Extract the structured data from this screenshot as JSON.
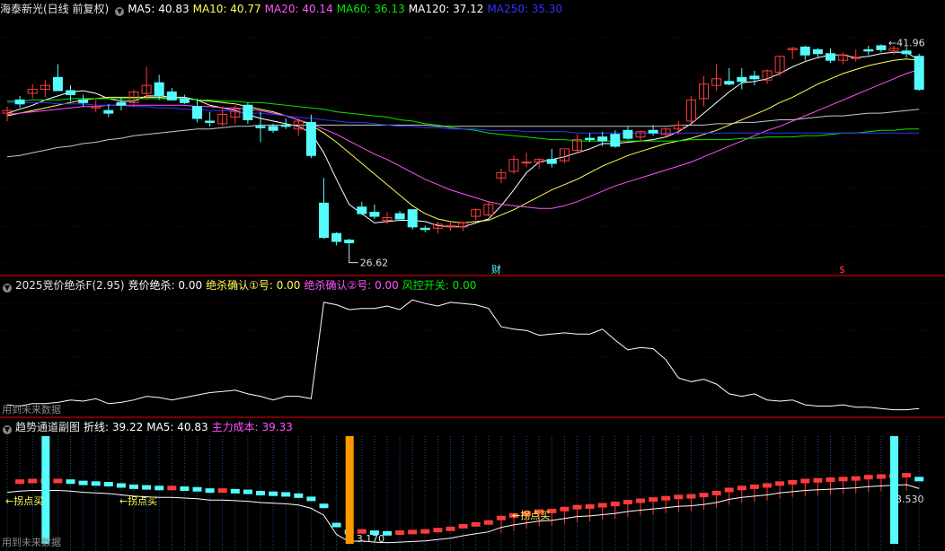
{
  "colors": {
    "up": "#ff3b3b",
    "down": "#54fcfc",
    "ma5": "#ffffff",
    "ma10": "#ffff54",
    "ma20": "#ff54ff",
    "ma60": "#00e800",
    "ma120": "#c8c8c8",
    "ma250": "#3232ff"
  },
  "main": {
    "title": "海泰新光(日线 前复权)",
    "legend": [
      {
        "label": "MA5: 40.83",
        "color": "#ffffff"
      },
      {
        "label": "MA10: 40.77",
        "color": "#ffff54"
      },
      {
        "label": "MA20: 40.14",
        "color": "#ff54ff"
      },
      {
        "label": "MA60: 36.13",
        "color": "#00e800"
      },
      {
        "label": "MA120: 37.12",
        "color": "#ffffff"
      },
      {
        "label": "MA250: 35.30",
        "color": "#3232ff"
      }
    ],
    "high_label": "41.96",
    "low_label": "26.62",
    "marker_cai": "财",
    "marker_s": "$"
  },
  "sub1": {
    "title": "2025竞价绝杀F(2.95)",
    "legend": [
      {
        "label": "竞价绝杀: 0.00",
        "color": "#ffffff"
      },
      {
        "label": "绝杀确认①号: 0.00",
        "color": "#ffff54"
      },
      {
        "label": "绝杀确认②号: 0.00",
        "color": "#ff54ff"
      },
      {
        "label": "风控开关: 0.00",
        "color": "#00e800"
      }
    ],
    "note": "用到未来数据"
  },
  "sub2": {
    "title": "趋势通道副图",
    "legend": [
      {
        "label": "折线: 39.22",
        "color": "#ffffff"
      },
      {
        "label": "MA5: 40.83",
        "color": "#ffffff"
      },
      {
        "label": "主力成本: 39.33",
        "color": "#ff54ff"
      }
    ],
    "note": "用到未来数据",
    "buy_labels": [
      "←拐点买",
      "←拐点买",
      "←拐点买"
    ],
    "value_left": "3.170",
    "value_right": "3.530"
  },
  "chart_data": [
    {
      "type": "candlestick",
      "title": "海泰新光(日线 前复权)",
      "ylim": [
        25,
        44
      ],
      "candles": [
        [
          36.8,
          37.3,
          36.2,
          37.0
        ],
        [
          37.8,
          38.1,
          37.2,
          37.5
        ],
        [
          38.3,
          39.0,
          37.9,
          38.6
        ],
        [
          38.6,
          39.3,
          38.0,
          38.9
        ],
        [
          39.5,
          40.5,
          38.7,
          38.5
        ],
        [
          38.5,
          38.9,
          37.7,
          38.2
        ],
        [
          37.8,
          38.2,
          37.3,
          37.6
        ],
        [
          37.2,
          37.8,
          36.9,
          37.3
        ],
        [
          37.0,
          37.5,
          36.5,
          36.8
        ],
        [
          37.6,
          38.0,
          37.0,
          37.4
        ],
        [
          37.6,
          38.6,
          37.3,
          38.4
        ],
        [
          38.3,
          40.3,
          37.8,
          38.9
        ],
        [
          39.1,
          39.7,
          37.8,
          38.1
        ],
        [
          38.4,
          38.7,
          37.8,
          37.8
        ],
        [
          37.9,
          38.2,
          37.5,
          37.6
        ],
        [
          37.3,
          37.9,
          36.1,
          36.4
        ],
        [
          36.2,
          36.9,
          35.8,
          36.1
        ],
        [
          36.0,
          37.3,
          35.8,
          36.7
        ],
        [
          36.5,
          37.4,
          36.0,
          37.1
        ],
        [
          37.4,
          37.6,
          36.0,
          36.3
        ],
        [
          35.8,
          36.9,
          34.6,
          35.7
        ],
        [
          35.8,
          36.0,
          35.3,
          35.5
        ],
        [
          35.9,
          36.4,
          35.6,
          35.8
        ],
        [
          35.6,
          36.4,
          35.1,
          36.2
        ],
        [
          36.1,
          36.7,
          33.4,
          33.6
        ],
        [
          30.0,
          31.9,
          27.3,
          27.4
        ],
        [
          27.7,
          27.8,
          26.8,
          27.1
        ],
        [
          27.2,
          27.3,
          26.6,
          27.0
        ],
        [
          29.7,
          30.1,
          29.1,
          29.2
        ],
        [
          29.3,
          29.9,
          28.8,
          29.0
        ],
        [
          28.7,
          29.3,
          28.4,
          28.9
        ],
        [
          29.2,
          29.4,
          28.8,
          28.8
        ],
        [
          29.5,
          29.5,
          28.0,
          28.2
        ],
        [
          28.1,
          28.3,
          27.8,
          28.0
        ],
        [
          28.1,
          28.6,
          27.7,
          28.4
        ],
        [
          28.2,
          28.6,
          27.9,
          28.3
        ],
        [
          28.2,
          28.6,
          27.9,
          28.5
        ],
        [
          29.0,
          29.6,
          28.7,
          29.5
        ],
        [
          29.1,
          30.1,
          29.0,
          29.9
        ],
        [
          31.9,
          32.6,
          31.5,
          32.3
        ],
        [
          32.4,
          33.6,
          32.2,
          33.3
        ],
        [
          33.1,
          33.8,
          32.7,
          33.1
        ],
        [
          33.1,
          33.4,
          32.6,
          33.3
        ],
        [
          33.3,
          34.1,
          32.7,
          33.0
        ],
        [
          33.2,
          34.0,
          33.0,
          34.1
        ],
        [
          34.0,
          35.2,
          33.8,
          34.8
        ],
        [
          34.9,
          35.3,
          34.6,
          34.8
        ],
        [
          35.0,
          35.4,
          34.3,
          34.7
        ],
        [
          35.2,
          35.5,
          34.2,
          34.3
        ],
        [
          35.5,
          35.8,
          34.8,
          34.9
        ],
        [
          35.0,
          35.5,
          34.6,
          35.4
        ],
        [
          35.5,
          35.9,
          35.1,
          35.3
        ],
        [
          35.2,
          35.7,
          35.0,
          35.6
        ],
        [
          35.6,
          36.2,
          35.2,
          35.9
        ],
        [
          36.2,
          38.1,
          36.0,
          37.8
        ],
        [
          37.9,
          39.6,
          37.3,
          39.0
        ],
        [
          38.9,
          40.5,
          38.5,
          39.4
        ],
        [
          39.2,
          40.2,
          38.9,
          39.0
        ],
        [
          39.5,
          40.2,
          38.6,
          39.2
        ],
        [
          39.6,
          40.0,
          38.9,
          39.4
        ],
        [
          39.3,
          40.1,
          39.0,
          40.0
        ],
        [
          39.9,
          41.1,
          39.6,
          41.1
        ],
        [
          41.6,
          41.8,
          40.9,
          41.7
        ],
        [
          41.8,
          41.9,
          40.8,
          41.2
        ],
        [
          41.6,
          41.7,
          41.0,
          41.3
        ],
        [
          41.3,
          41.7,
          40.6,
          40.8
        ],
        [
          40.8,
          41.4,
          40.5,
          41.2
        ],
        [
          41.0,
          41.6,
          40.7,
          41.0
        ],
        [
          41.6,
          41.9,
          41.2,
          41.5
        ],
        [
          41.9,
          42.0,
          41.4,
          41.6
        ],
        [
          41.5,
          41.9,
          41.2,
          41.7
        ],
        [
          41.5,
          41.8,
          41.0,
          41.3
        ],
        [
          41.1,
          41.3,
          38.5,
          38.6
        ]
      ],
      "series": [
        {
          "name": "MA5",
          "values": [
            36.8,
            37.1,
            37.4,
            37.8,
            38.1,
            38.4,
            38.5,
            38.3,
            37.9,
            37.7,
            37.7,
            38.1,
            38.1,
            38.0,
            38.0,
            37.8,
            37.4,
            37.2,
            37.0,
            36.7,
            36.4,
            36.2,
            36.0,
            35.8,
            35.3,
            33.8,
            31.8,
            29.9,
            29.2,
            28.5,
            28.6,
            28.7,
            28.7,
            28.6,
            28.3,
            28.2,
            28.2,
            28.5,
            28.8,
            29.8,
            31.0,
            32.3,
            33.1,
            33.3,
            33.5,
            33.8,
            34.1,
            34.5,
            34.5,
            34.6,
            34.7,
            34.8,
            35.0,
            35.4,
            36.0,
            36.8,
            37.6,
            38.4,
            39.1,
            39.2,
            39.4,
            39.8,
            40.3,
            40.7,
            41.0,
            41.2,
            41.2,
            41.0,
            41.1,
            41.3,
            41.4,
            41.4,
            40.8
          ]
        },
        {
          "name": "MA10",
          "values": [
            36.6,
            36.8,
            37.0,
            37.2,
            37.4,
            37.6,
            37.8,
            37.9,
            38.0,
            38.0,
            38.0,
            38.0,
            38.0,
            37.9,
            37.9,
            37.8,
            37.7,
            37.6,
            37.5,
            37.3,
            37.1,
            36.9,
            36.6,
            36.3,
            35.9,
            35.3,
            34.6,
            33.8,
            33.0,
            32.2,
            31.4,
            30.6,
            29.8,
            29.2,
            28.8,
            28.6,
            28.5,
            28.6,
            28.7,
            29.1,
            29.5,
            30.0,
            30.5,
            31.0,
            31.4,
            31.8,
            32.3,
            32.8,
            33.2,
            33.6,
            33.9,
            34.2,
            34.5,
            34.7,
            34.9,
            35.2,
            35.5,
            35.9,
            36.3,
            36.7,
            37.1,
            37.6,
            38.0,
            38.5,
            39.0,
            39.4,
            39.8,
            40.1,
            40.4,
            40.6,
            40.8,
            40.9,
            40.8
          ]
        },
        {
          "name": "MA20",
          "values": [
            36.7,
            36.8,
            36.9,
            37.0,
            37.1,
            37.2,
            37.3,
            37.3,
            37.4,
            37.4,
            37.4,
            37.4,
            37.4,
            37.4,
            37.4,
            37.3,
            37.3,
            37.2,
            37.2,
            37.1,
            37.0,
            36.8,
            36.6,
            36.3,
            36.0,
            35.6,
            35.2,
            34.7,
            34.2,
            33.7,
            33.3,
            32.8,
            32.3,
            31.8,
            31.4,
            31.0,
            30.7,
            30.4,
            30.1,
            29.9,
            29.8,
            29.7,
            29.6,
            29.6,
            29.8,
            30.1,
            30.5,
            30.9,
            31.3,
            31.6,
            31.9,
            32.2,
            32.5,
            32.8,
            33.1,
            33.5,
            33.9,
            34.3,
            34.7,
            35.1,
            35.5,
            35.8,
            36.2,
            36.6,
            37.0,
            37.4,
            37.8,
            38.2,
            38.6,
            39.0,
            39.4,
            39.8,
            40.1
          ]
        },
        {
          "name": "MA60",
          "values": [
            37.7,
            37.7,
            37.8,
            37.8,
            37.8,
            37.9,
            37.9,
            37.9,
            37.9,
            37.9,
            37.9,
            37.9,
            37.9,
            37.9,
            37.9,
            37.8,
            37.8,
            37.7,
            37.7,
            37.6,
            37.6,
            37.5,
            37.4,
            37.3,
            37.2,
            37.1,
            36.9,
            36.8,
            36.7,
            36.6,
            36.5,
            36.3,
            36.2,
            36.0,
            35.9,
            35.7,
            35.6,
            35.5,
            35.3,
            35.2,
            35.1,
            35.0,
            34.9,
            34.8,
            34.8,
            34.7,
            34.7,
            34.7,
            34.7,
            34.7,
            34.7,
            34.7,
            34.7,
            34.7,
            34.8,
            34.8,
            34.8,
            34.8,
            34.9,
            34.9,
            35.0,
            35.0,
            35.0,
            35.1,
            35.1,
            35.2,
            35.3,
            35.3,
            35.4,
            35.5,
            35.5,
            35.6,
            35.6
          ]
        },
        {
          "name": "MA120",
          "values": [
            33.5,
            33.6,
            33.8,
            34.0,
            34.2,
            34.3,
            34.5,
            34.6,
            34.8,
            34.9,
            35.1,
            35.2,
            35.3,
            35.4,
            35.5,
            35.6,
            35.6,
            35.7,
            35.8,
            35.8,
            35.9,
            35.9,
            35.9,
            35.9,
            35.9,
            35.9,
            35.9,
            35.9,
            35.9,
            35.9,
            35.9,
            35.9,
            35.9,
            35.9,
            35.8,
            35.8,
            35.8,
            35.8,
            35.8,
            35.8,
            35.8,
            35.8,
            35.8,
            35.8,
            35.8,
            35.8,
            35.8,
            35.8,
            35.8,
            35.8,
            35.8,
            35.8,
            35.8,
            35.9,
            35.9,
            35.9,
            36.0,
            36.0,
            36.1,
            36.1,
            36.2,
            36.3,
            36.3,
            36.4,
            36.5,
            36.6,
            36.6,
            36.7,
            36.8,
            36.8,
            36.9,
            37.0,
            37.1
          ]
        },
        {
          "name": "MA250",
          "values": [
            37.6,
            37.6,
            37.6,
            37.6,
            37.5,
            37.5,
            37.5,
            37.4,
            37.4,
            37.4,
            37.3,
            37.3,
            37.2,
            37.2,
            37.1,
            37.1,
            37.0,
            37.0,
            36.9,
            36.8,
            36.8,
            36.7,
            36.6,
            36.5,
            36.4,
            36.3,
            36.2,
            36.1,
            36.1,
            36.0,
            35.9,
            35.8,
            35.8,
            35.7,
            35.7,
            35.6,
            35.6,
            35.6,
            35.5,
            35.5,
            35.5,
            35.4,
            35.4,
            35.4,
            35.4,
            35.3,
            35.3,
            35.3,
            35.3,
            35.3,
            35.3,
            35.3,
            35.3,
            35.3,
            35.3,
            35.3,
            35.3,
            35.3,
            35.3,
            35.3,
            35.3,
            35.3,
            35.3,
            35.3,
            35.3,
            35.3,
            35.3,
            35.3,
            35.3,
            35.3,
            35.3,
            35.3,
            35.3
          ]
        }
      ]
    },
    {
      "type": "line",
      "title": "2025竞价绝杀F(2.95)",
      "series": [
        {
          "name": "竞价绝杀",
          "values": [
            8,
            7,
            9,
            9,
            10,
            12,
            11,
            13,
            9,
            10,
            12,
            15,
            14,
            12,
            14,
            16,
            18,
            19,
            20,
            17,
            15,
            12,
            15,
            15,
            13,
            92,
            90,
            86,
            87,
            87,
            89,
            86,
            94,
            91,
            89,
            92,
            91,
            90,
            87,
            72,
            70,
            69,
            65,
            66,
            67,
            66,
            66,
            70,
            61,
            53,
            55,
            54,
            45,
            30,
            27,
            29,
            25,
            17,
            15,
            17,
            12,
            11,
            12,
            8,
            7,
            7,
            8,
            6,
            6,
            5,
            4,
            4,
            5
          ]
        }
      ]
    },
    {
      "type": "bar",
      "title": "趋势通道副图",
      "series": [
        {
          "name": "折线",
          "values": [
            38.6,
            38.8,
            38.9,
            38.9,
            38.9,
            38.8,
            38.6,
            38.5,
            38.4,
            38.2,
            38.0,
            37.9,
            37.8,
            37.8,
            37.7,
            37.6,
            37.4,
            37.4,
            37.3,
            37.2,
            37.0,
            36.9,
            36.8,
            36.6,
            36.1,
            35.0,
            32.0,
            30.9,
            31.0,
            30.8,
            30.7,
            30.8,
            30.9,
            31.0,
            31.2,
            31.4,
            31.8,
            32.1,
            32.4,
            33.1,
            33.5,
            33.8,
            34.1,
            34.2,
            34.5,
            34.8,
            34.9,
            35.1,
            35.3,
            35.6,
            35.8,
            36.0,
            36.2,
            36.4,
            36.5,
            36.7,
            37.0,
            37.5,
            37.8,
            38.0,
            38.2,
            38.5,
            38.7,
            38.9,
            39.0,
            39.1,
            39.2,
            39.3,
            39.5,
            39.6,
            39.7,
            39.8,
            39.2
          ]
        }
      ]
    }
  ]
}
